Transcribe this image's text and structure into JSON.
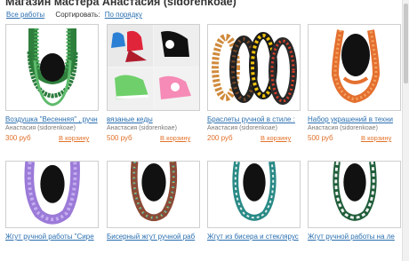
{
  "page": {
    "title": "Магазин мастера Анастасия (sidorenkoae)",
    "all_works_link": "Все работы",
    "sort_label": "Сортировать:",
    "sort_value": "По порядку"
  },
  "products": [
    {
      "name": "Воздушка \"Весенняя\" , ручн",
      "author": "Анастасия (sidorenkoae)",
      "price": "300 руб",
      "cart": "В корзину",
      "image": "green-bead-necklace"
    },
    {
      "name": "вязаные кеды",
      "author": "Анастасия (sidorenkoae)",
      "price": "500 руб",
      "cart": "В корзину",
      "image": "knitted-sneakers"
    },
    {
      "name": "Браслеты ручной в стиле :",
      "author": "Анастасия (sidorenkoae)",
      "price": "200 руб",
      "cart": "В корзину",
      "image": "beaded-bracelets"
    },
    {
      "name": "Набор украшений в техни",
      "author": "Анастасия (sidorenkoae)",
      "price": "500 руб",
      "cart": "В корзину",
      "image": "orange-bead-necklace"
    },
    {
      "name": "Жгут ручной работы \"Сире",
      "author": "",
      "price": "",
      "cart": "",
      "image": "lilac-rope-necklace"
    },
    {
      "name": "Бисерный жгут ручной раб",
      "author": "",
      "price": "",
      "cart": "",
      "image": "multicolor-rope-necklace"
    },
    {
      "name": "Жгут из бисера и стеклярус",
      "author": "",
      "price": "",
      "cart": "",
      "image": "teal-rope-necklace"
    },
    {
      "name": "Жгут ручной работы на ле",
      "author": "",
      "price": "",
      "cart": "",
      "image": "green-spiral-necklace"
    }
  ],
  "colors": {
    "link": "#2a6fb0",
    "price": "#e2712a",
    "text": "#333333",
    "muted": "#777777"
  }
}
